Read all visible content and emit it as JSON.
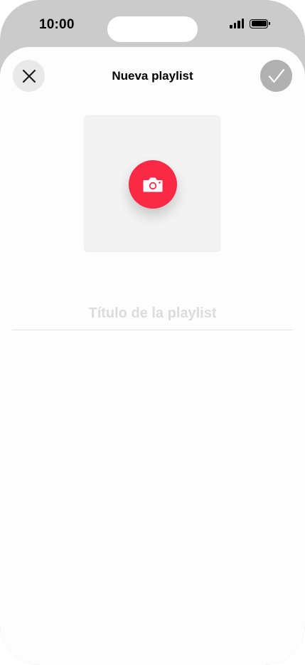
{
  "status_bar": {
    "time": "10:00",
    "icons": [
      "signal-icon",
      "battery-icon"
    ]
  },
  "header": {
    "title": "Nueva playlist",
    "close_icon": "close-icon",
    "done_icon": "checkmark-icon"
  },
  "artwork": {
    "camera_icon": "camera-icon"
  },
  "title_field": {
    "value": "",
    "placeholder": "Título de la playlist"
  },
  "colors": {
    "accent": "#fa2a47",
    "frame": "#cbcbcb",
    "sheet": "#fdfdfd"
  }
}
